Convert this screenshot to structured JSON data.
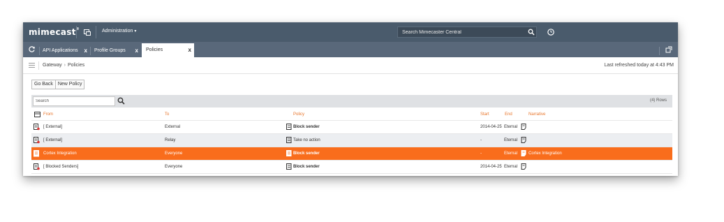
{
  "app": {
    "logo_text": "mimecast",
    "logo_sup": "®",
    "admin_menu": "Administration",
    "search_placeholder": "Search Mimecaster Central"
  },
  "tabs": [
    {
      "label": "API Applications",
      "close": "x",
      "active": false
    },
    {
      "label": "Profile Groups",
      "close": "x",
      "active": false
    },
    {
      "label": "Policies",
      "close": "x",
      "active": true
    }
  ],
  "breadcrumb": {
    "parent": "Gateway",
    "separator": "›",
    "current": "Policies",
    "refreshed": "Last refreshed today at 4:43 PM"
  },
  "buttons": {
    "go_back": "Go Back",
    "new_policy": "New Policy"
  },
  "grid": {
    "search_placeholder": "Search",
    "rows_count": "(4) Rows"
  },
  "table": {
    "columns": {
      "from": "From",
      "to": "To",
      "policy": "Policy",
      "start": "Start",
      "end": "End",
      "narrative": "Narrative"
    },
    "rows": [
      {
        "from": "[ External]",
        "to": "External",
        "policy": "Block sender",
        "start": "2014-04-25",
        "end": "Eternal",
        "narrative": ""
      },
      {
        "from": "[ External]",
        "to": "Relay",
        "policy": "Take no action",
        "start": "-",
        "end": "Eternal",
        "narrative": ""
      },
      {
        "from": "Cortex Integration",
        "to": "Everyone",
        "policy": "Block sender",
        "start": "-",
        "end": "Eternal",
        "narrative": "Cortex Integration"
      },
      {
        "from": "[ Blocked Senders]",
        "to": "Everyone",
        "policy": "Block sender",
        "start": "2014-04-25",
        "end": "Eternal",
        "narrative": ""
      }
    ]
  },
  "colors": {
    "topbar": "#4a5b6c",
    "tabbar": "#59687a",
    "accent": "#e8752a",
    "selected_row": "#f96d1c"
  }
}
